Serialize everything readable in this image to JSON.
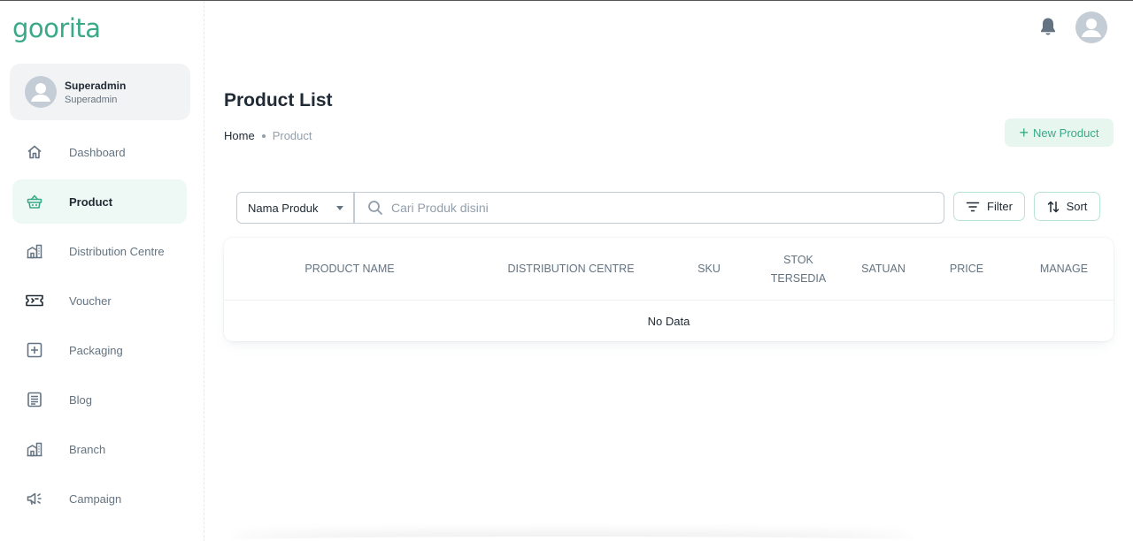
{
  "brand": {
    "logo_text": "goorita",
    "accent": "#3aa987"
  },
  "user": {
    "name": "Superadmin",
    "role": "Superadmin"
  },
  "sidebar": {
    "items": [
      {
        "label": "Dashboard",
        "icon": "home-icon",
        "active": false
      },
      {
        "label": "Product",
        "icon": "basket-icon",
        "active": true
      },
      {
        "label": "Distribution Centre",
        "icon": "building-icon",
        "active": false
      },
      {
        "label": "Voucher",
        "icon": "ticket-icon",
        "active": false
      },
      {
        "label": "Packaging",
        "icon": "plus-box-icon",
        "active": false
      },
      {
        "label": "Blog",
        "icon": "document-icon",
        "active": false
      },
      {
        "label": "Branch",
        "icon": "building-icon",
        "active": false
      },
      {
        "label": "Campaign",
        "icon": "megaphone-icon",
        "active": false
      }
    ]
  },
  "header": {
    "notification_icon": "bell-icon",
    "avatar_icon": "user-avatar-icon"
  },
  "page": {
    "title": "Product List",
    "breadcrumb": {
      "home": "Home",
      "current": "Product"
    },
    "new_button": "New Product"
  },
  "toolbar": {
    "select_value": "Nama Produk",
    "search_placeholder": "Cari Produk disini",
    "filter_label": "Filter",
    "sort_label": "Sort"
  },
  "table": {
    "columns": [
      "PRODUCT NAME",
      "DISTRIBUTION CENTRE",
      "SKU",
      "STOK TERSEDIA",
      "SATUAN",
      "PRICE",
      "MANAGE"
    ],
    "empty_text": "No Data"
  }
}
